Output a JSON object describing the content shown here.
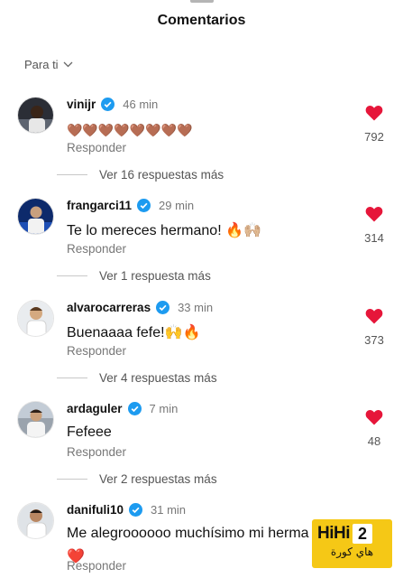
{
  "header": {
    "title": "Comentarios"
  },
  "filter": {
    "label": "Para ti"
  },
  "colors": {
    "like": "#e6163a",
    "verified": "#1d9bf0",
    "watermark": "#f5c816"
  },
  "comments": [
    {
      "username": "vinijr",
      "verified": true,
      "time": "46 min",
      "text": "🤎🤎🤎🤎🤎🤎🤎🤎",
      "text2": "",
      "reply": "Responder",
      "likes": "792",
      "more": "Ver 16 respuestas más"
    },
    {
      "username": "frangarci11",
      "verified": true,
      "time": "29 min",
      "text": "Te lo mereces hermano! 🔥🙌🏼",
      "text2": "",
      "reply": "Responder",
      "likes": "314",
      "more": "Ver 1 respuesta más"
    },
    {
      "username": "alvarocarreras",
      "verified": true,
      "time": "33 min",
      "text": "Buenaaaa fefe!🙌🔥",
      "text2": "",
      "reply": "Responder",
      "likes": "373",
      "more": "Ver 4 respuestas más"
    },
    {
      "username": "ardaguler",
      "verified": true,
      "time": "7 min",
      "text": "Fefeee",
      "text2": "",
      "reply": "Responder",
      "likes": "48",
      "more": "Ver 2 respuestas más"
    },
    {
      "username": "danifuli10",
      "verified": true,
      "time": "31 min",
      "text": "Me alegroooooo muchísimo mi herma",
      "text2": "❤️",
      "reply": "Responder",
      "likes": "",
      "more": ""
    }
  ],
  "watermark": {
    "brand": "HiHi",
    "number": "2",
    "arabic": "هاي كورة"
  }
}
